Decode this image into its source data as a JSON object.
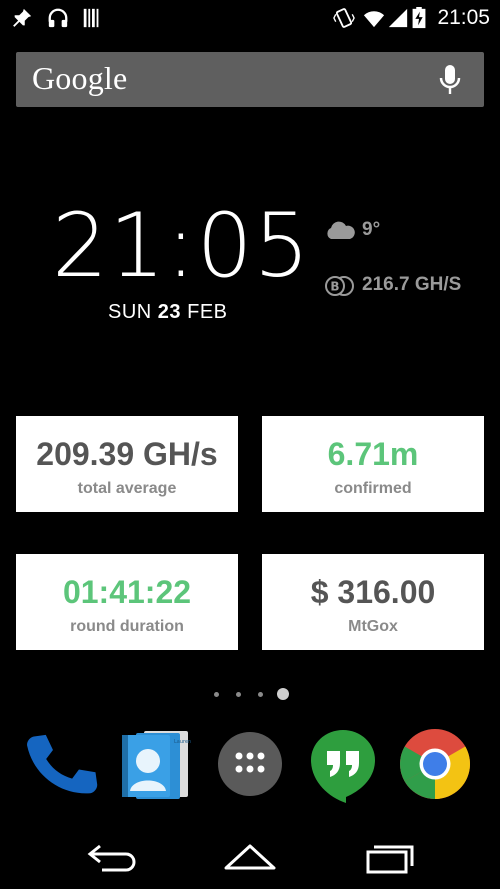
{
  "status_bar": {
    "time": "21:05",
    "left_icons": [
      "pin-icon",
      "headphones-icon",
      "barcode-icon"
    ],
    "right_icons": [
      "vibrate-icon",
      "wifi-icon",
      "signal-icon",
      "battery-icon"
    ]
  },
  "search": {
    "logo_text": "Google",
    "mic_icon": "microphone-icon"
  },
  "clock": {
    "time": "21:05",
    "day": "SUN",
    "date_num": "23",
    "month": "FEB"
  },
  "weather": {
    "icon": "cloud-icon",
    "temperature": "9°"
  },
  "hashrate": {
    "icon": "bitcoin-icon",
    "value": "216.7 GH/S"
  },
  "cards": [
    {
      "value": "209.39 GH/s",
      "label": "total average",
      "color": "#555555"
    },
    {
      "value": "6.71m",
      "label": "confirmed",
      "color": "#5cc57a"
    },
    {
      "value": "01:41:22",
      "label": "round duration",
      "color": "#5cc57a"
    },
    {
      "value": "$ 316.00",
      "label": "MtGox",
      "color": "#555555"
    }
  ],
  "pages": {
    "count": 4,
    "active": 4
  },
  "dock": {
    "icons": [
      "phone-icon",
      "contacts-icon",
      "app-drawer-icon",
      "hangouts-icon",
      "chrome-icon"
    ],
    "contacts_card_text": "Lauren Ipsum"
  },
  "nav": {
    "icons": [
      "back-icon",
      "home-icon",
      "recents-icon"
    ]
  },
  "colors": {
    "background": "#000000",
    "search_bar": "#5f5f5f",
    "accent_green": "#5cc57a",
    "card_text": "#555555",
    "secondary_text": "#9a9a9a"
  }
}
